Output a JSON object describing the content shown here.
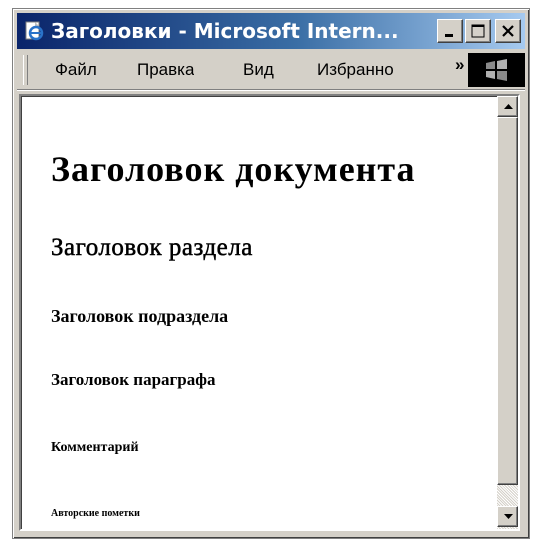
{
  "window": {
    "title": "Заголовки - Microsoft Intern...",
    "buttons": {
      "minimize": "minimize",
      "maximize": "maximize",
      "close": "close"
    }
  },
  "menu": {
    "items": [
      "Файл",
      "Правка",
      "Вид",
      "Избранно"
    ],
    "more": "»"
  },
  "document": {
    "h1": "Заголовок документа",
    "h2": "Заголовок раздела",
    "h3": "Заголовок подраздела",
    "h4": "Заголовок параграфа",
    "h5": "Комментарий",
    "h6": "Авторские пометки"
  },
  "icons": {
    "app": "ie-page-icon",
    "throbber": "windows-logo-icon",
    "scroll_up": "scroll-up-arrow-icon",
    "scroll_down": "scroll-down-arrow-icon"
  },
  "colors": {
    "titlebar_start": "#0a246a",
    "titlebar_end": "#a6caf0",
    "chrome": "#d4d0c8"
  }
}
